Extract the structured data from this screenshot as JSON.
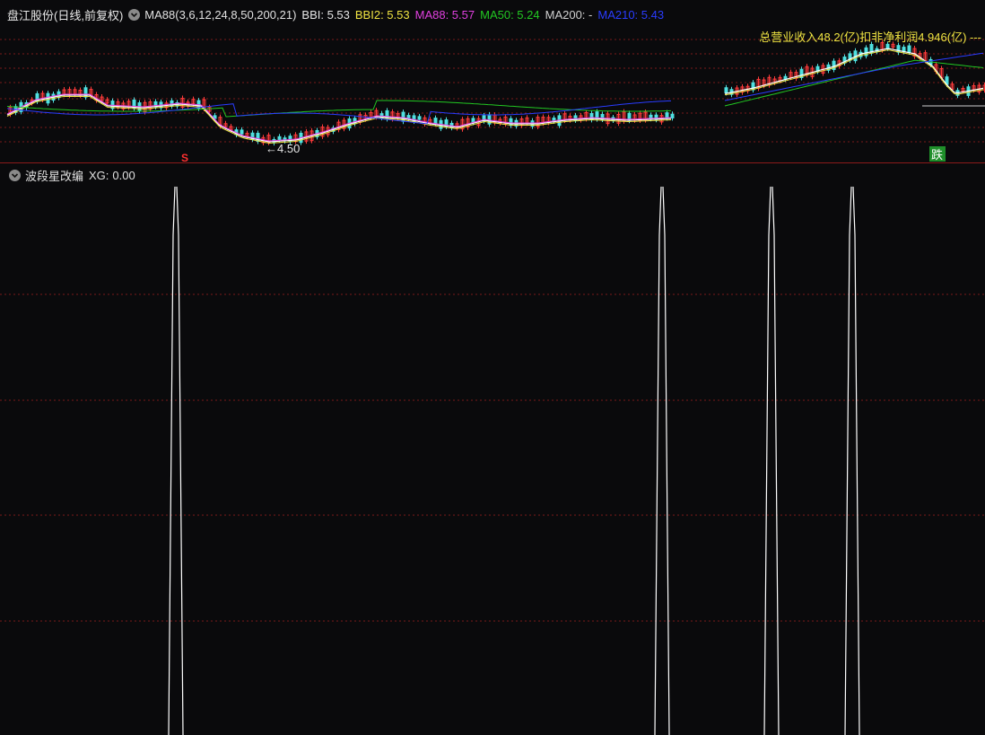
{
  "header": {
    "stock_name": "盘江股份(日线,前复权)",
    "ma_params": "MA88(3,6,12,24,8,50,200,21)",
    "indicators": [
      {
        "label": "BBI:",
        "value": "5.53",
        "color": "#e6e6e6"
      },
      {
        "label": "BBI2:",
        "value": "5.53",
        "color": "#f0e442"
      },
      {
        "label": "MA88:",
        "value": "5.57",
        "color": "#e040e0"
      },
      {
        "label": "MA50:",
        "value": "5.24",
        "color": "#22c822"
      },
      {
        "label": "MA200:",
        "value": "-",
        "color": "#d0d0d0"
      },
      {
        "label": "MA210:",
        "value": "5.43",
        "color": "#2a3cff"
      }
    ],
    "revenue_note": "总营业收入48.2(亿)扣非净利润4.946(亿) ---"
  },
  "annotations": {
    "low_price": "←4.50",
    "sell_mark": "S",
    "fall_mark": "跌"
  },
  "sub_panel": {
    "title": "波段星改编",
    "xg_label": "XG:",
    "xg_value": "0.00"
  },
  "colors": {
    "up": "#ff3b3b",
    "down": "#4fe0e0",
    "grid": "#7a1a1a",
    "signal_line": "#ffffff"
  },
  "chart_data": {
    "type": "line",
    "series": [
      {
        "name": "XG",
        "spikes": [
          196,
          738,
          860,
          950
        ],
        "values": [
          1,
          1,
          1,
          1
        ]
      }
    ]
  }
}
